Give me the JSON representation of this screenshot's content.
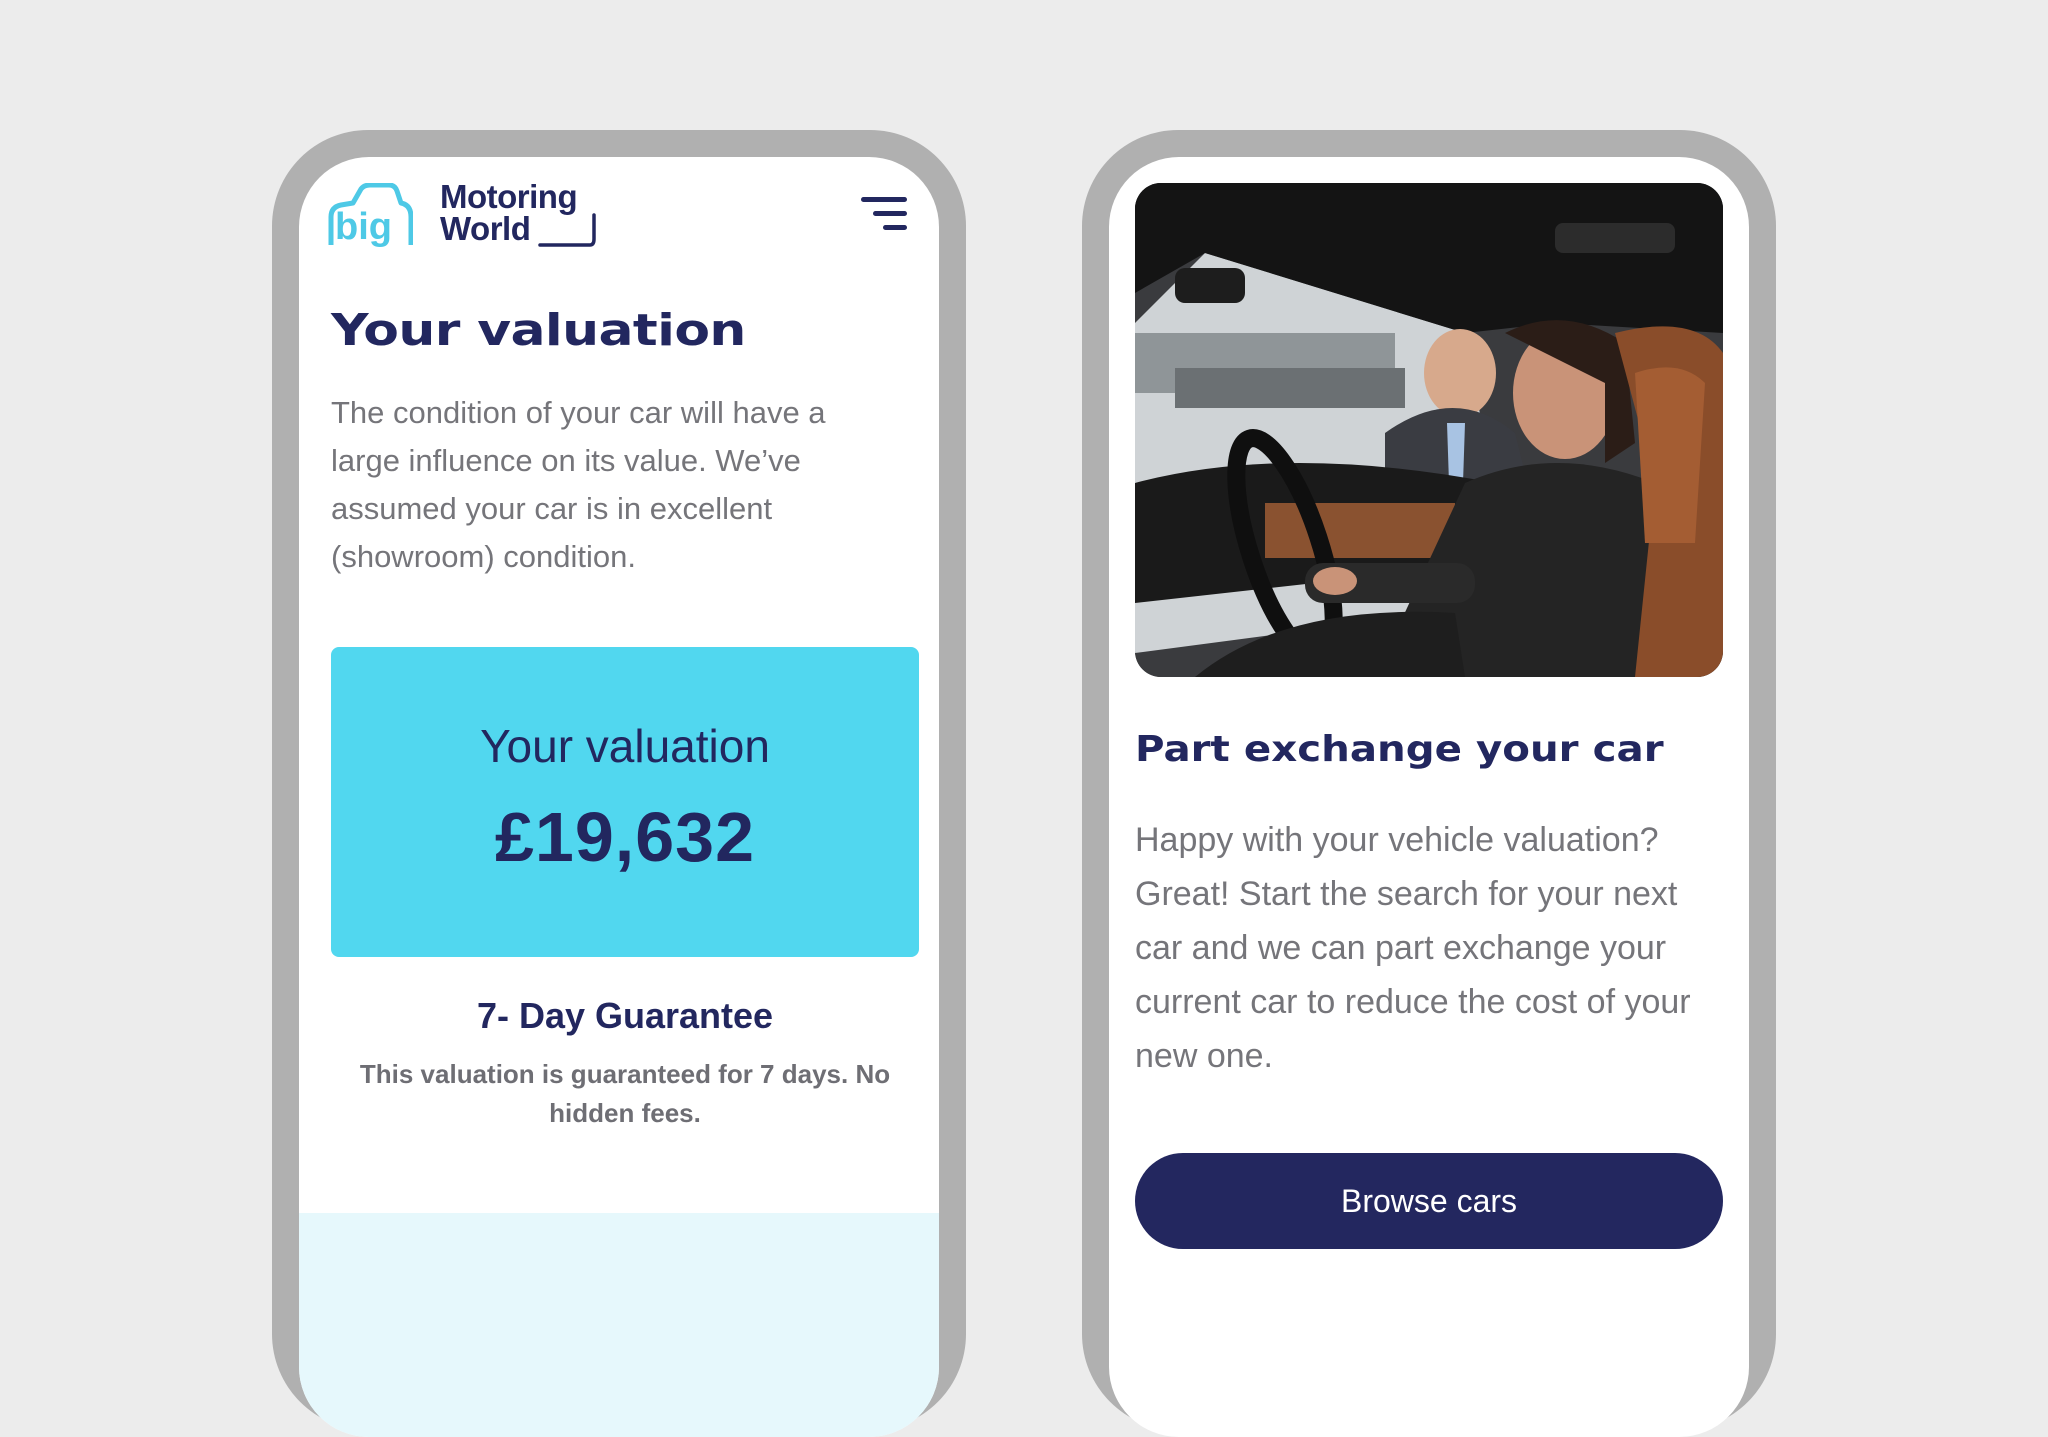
{
  "brand": {
    "logo_mark_text": "big",
    "name_line1": "Motoring",
    "name_line2": "World"
  },
  "colors": {
    "navy": "#22275f",
    "cyan": "#51d7ef",
    "logo_cyan": "#4ec9e6",
    "body_text": "#75757a",
    "background": "#ececec",
    "light_band": "#e6f8fc"
  },
  "left_screen": {
    "menu_icon": "hamburger-menu-icon",
    "title": "Your valuation",
    "intro": "The condition of your car will have a large influence on its value. We’ve assumed your car is in excellent (showroom) condition.",
    "valuation_card": {
      "label": "Your valuation",
      "amount": "£19,632"
    },
    "guarantee": {
      "title": "7- Day Guarantee",
      "text": "This valuation is guaranteed for 7 days. No hidden fees."
    }
  },
  "right_screen": {
    "photo_description_icon": "car-dealership-photo",
    "title": "Part exchange your car",
    "text": "Happy with your vehicle valuation? Great! Start the search for your next car and we can part exchange your current car to reduce the cost of your new one.",
    "button_label": "Browse cars"
  }
}
